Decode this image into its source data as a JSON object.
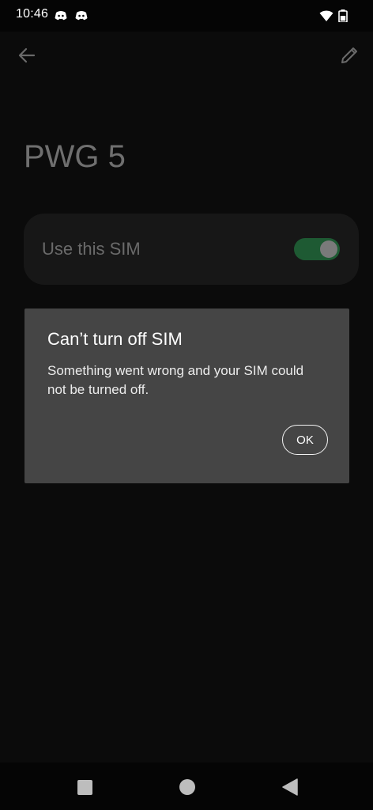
{
  "status_bar": {
    "time": "10:46",
    "icons": [
      "discord-icon",
      "discord-icon",
      "wifi-icon",
      "battery-icon"
    ]
  },
  "toolbar": {
    "back_icon": "arrow-left-icon",
    "edit_icon": "pencil-icon"
  },
  "page": {
    "title": "PWG 5"
  },
  "sim_setting": {
    "label": "Use this SIM",
    "toggle_on": true
  },
  "dialog": {
    "title": "Can’t turn off SIM",
    "message": "Something went wrong and your SIM could not be turned off.",
    "ok_label": "OK"
  },
  "nav_bar": {
    "icons": [
      "square-icon",
      "circle-icon",
      "triangle-back-icon"
    ]
  },
  "colors": {
    "background": "#000000",
    "dialog": "#454545",
    "toggle_track": "#1e5a33"
  }
}
